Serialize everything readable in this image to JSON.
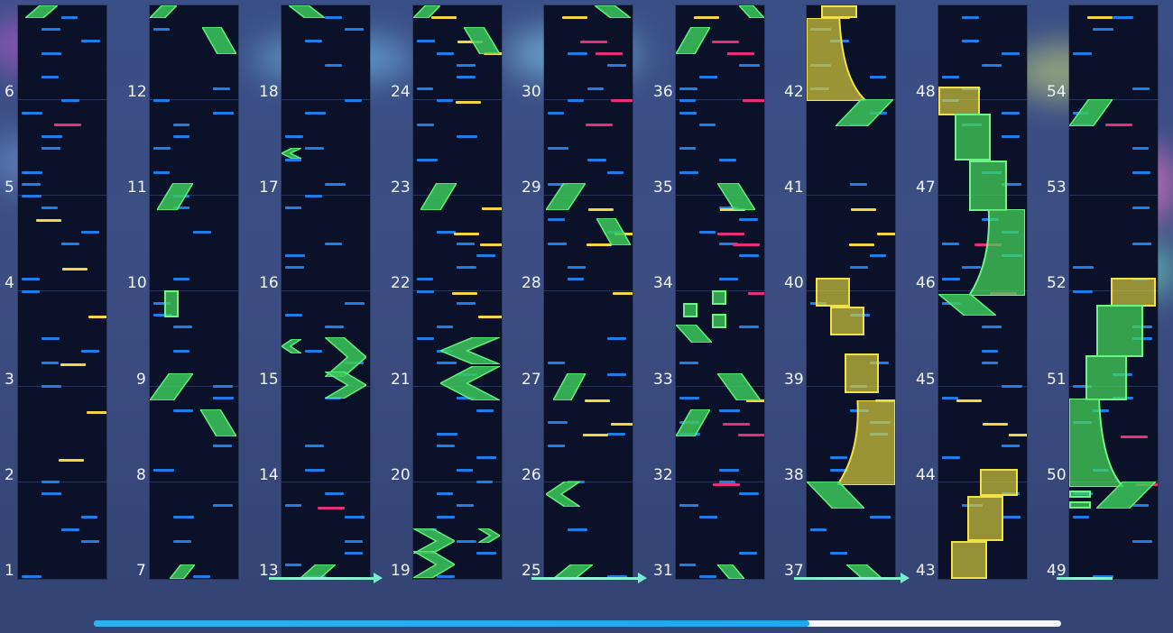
{
  "scene": {
    "lanes": [
      {
        "labels": [
          "6",
          "5",
          "4",
          "3",
          "2",
          "1"
        ]
      },
      {
        "labels": [
          "12",
          "11",
          "10",
          "9",
          "8",
          "7"
        ]
      },
      {
        "labels": [
          "18",
          "17",
          "16",
          "15",
          "14",
          "13"
        ]
      },
      {
        "labels": [
          "24",
          "23",
          "22",
          "21",
          "20",
          "19"
        ]
      },
      {
        "labels": [
          "30",
          "29",
          "28",
          "27",
          "26",
          "25"
        ]
      },
      {
        "labels": [
          "36",
          "35",
          "34",
          "33",
          "32",
          "31"
        ]
      },
      {
        "labels": [
          "42",
          "41",
          "40",
          "39",
          "38",
          "37"
        ]
      },
      {
        "labels": [
          "48",
          "47",
          "46",
          "45",
          "44",
          "43"
        ]
      },
      {
        "labels": [
          "54",
          "53",
          "52",
          "51",
          "50",
          "49"
        ]
      }
    ],
    "colors": {
      "tap_note": "#1f7fe8",
      "yellow_note": "#f3d640",
      "pink_note": "#e8307a",
      "flick_note": "#2fd35a",
      "hold_note": "#e2d23c",
      "lane_bg": "#0a1128"
    }
  },
  "progress": {
    "fraction": 0.74
  }
}
